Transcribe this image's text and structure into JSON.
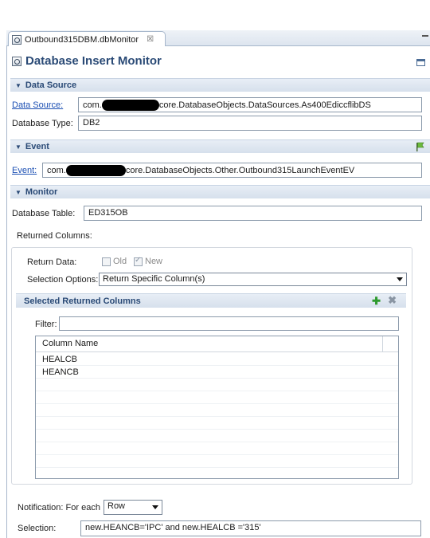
{
  "tab": {
    "title": "Outbound315DBM.dbMonitor",
    "close": "☒"
  },
  "form": {
    "title": "Database Insert Monitor"
  },
  "data_source": {
    "section_title": "Data Source",
    "source_label": "Data Source:",
    "source_prefix": "com.",
    "source_suffix": "core.DatabaseObjects.DataSources.As400EdiccflibDS",
    "type_label": "Database Type:",
    "type_value": "DB2"
  },
  "event": {
    "section_title": "Event",
    "event_label": "Event:",
    "event_prefix": "com.",
    "event_suffix": "core.DatabaseObjects.Other.Outbound315LaunchEventEV"
  },
  "monitor": {
    "section_title": "Monitor",
    "table_label": "Database Table:",
    "table_value": "ED315OB",
    "returned_columns_label": "Returned Columns:",
    "return_data_label": "Return Data:",
    "old_label": "Old",
    "new_label": "New",
    "selection_options_label": "Selection Options:",
    "selection_options_value": "Return Specific Column(s)",
    "selected_columns_title": "Selected Returned Columns",
    "filter_label": "Filter:",
    "filter_value": "",
    "column_header": "Column Name",
    "columns": [
      "HEALCB",
      "HEANCB"
    ],
    "notification_label": "Notification: For each",
    "notification_value": "Row",
    "selection_label": "Selection:",
    "selection_value": "new.HEANCB='IPC' and new.HEALCB ='315'"
  },
  "colors": {
    "header_text": "#2a4a76",
    "link": "#1b4fb3",
    "section_bg": "#d6e0ec"
  }
}
